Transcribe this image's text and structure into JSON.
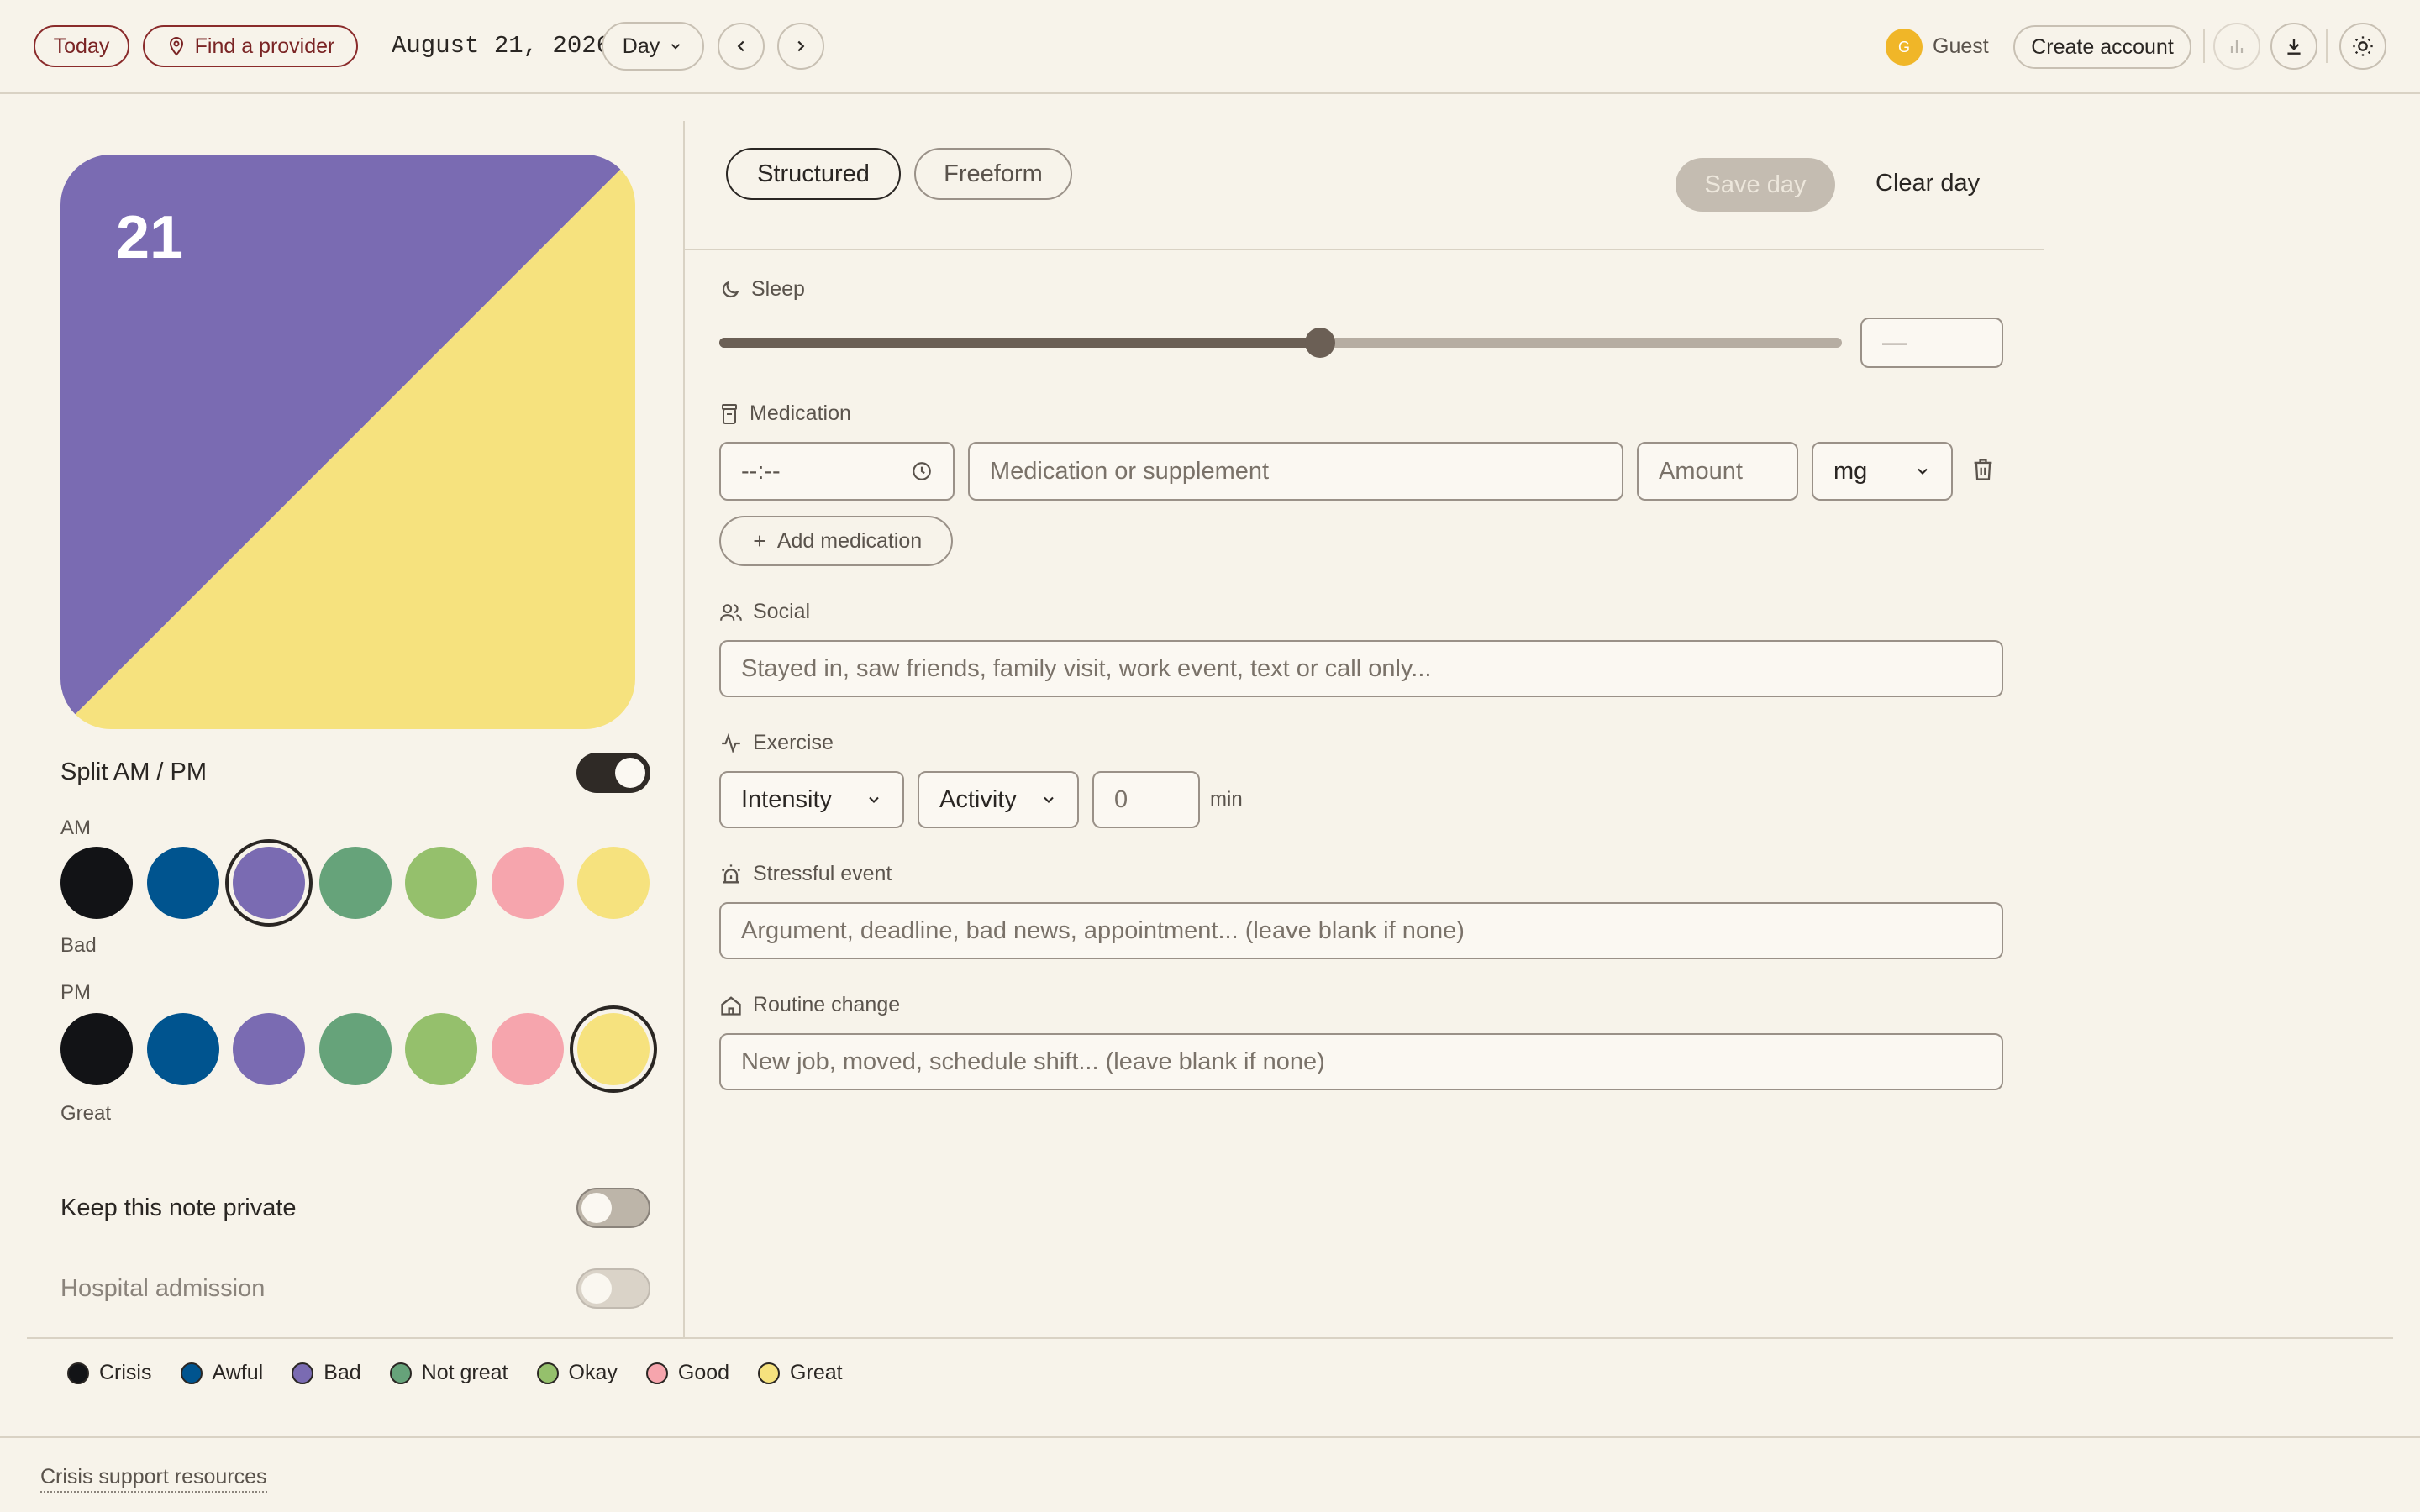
{
  "header": {
    "today_label": "Today",
    "find_provider_label": "Find a provider",
    "date": "August 21, 2026",
    "view_select": "Day",
    "user_initial": "G",
    "user_name": "Guest",
    "create_account_label": "Create account"
  },
  "day_card": {
    "day_number": "21",
    "am_color": "#7a6bb2",
    "pm_color": "#f6e27e"
  },
  "left_panel": {
    "split_label": "Split AM / PM",
    "split_on": true,
    "am_label": "AM",
    "am_mood": "Bad",
    "pm_label": "PM",
    "pm_mood": "Great",
    "private_label": "Keep this note private",
    "hospital_label": "Hospital admission"
  },
  "palette": [
    {
      "name": "Crisis",
      "color": "#121316"
    },
    {
      "name": "Awful",
      "color": "#00548f"
    },
    {
      "name": "Bad",
      "color": "#7a6bb2"
    },
    {
      "name": "Not great",
      "color": "#66a37a"
    },
    {
      "name": "Okay",
      "color": "#95c06c"
    },
    {
      "name": "Good",
      "color": "#f6a5ad"
    },
    {
      "name": "Great",
      "color": "#f6e27e"
    }
  ],
  "tabs": {
    "structured": "Structured",
    "freeform": "Freeform",
    "save_label": "Save day",
    "clear_label": "Clear day"
  },
  "sleep": {
    "label": "Sleep",
    "value_display": "—",
    "slider_fraction": 0.535
  },
  "medication": {
    "label": "Medication",
    "time_value": "--:--",
    "name_placeholder": "Medication or supplement",
    "amount_placeholder": "Amount",
    "unit": "mg",
    "add_label": "Add medication"
  },
  "social": {
    "label": "Social",
    "placeholder": "Stayed in, saw friends, family visit, work event, text or call only..."
  },
  "exercise": {
    "label": "Exercise",
    "intensity": "Intensity",
    "activity": "Activity",
    "minutes": "0",
    "unit": "min"
  },
  "stress": {
    "label": "Stressful event",
    "placeholder": "Argument, deadline, bad news, appointment... (leave blank if none)"
  },
  "routine": {
    "label": "Routine change",
    "placeholder": "New job, moved, schedule shift... (leave blank if none)"
  },
  "legend": [
    "Crisis",
    "Awful",
    "Bad",
    "Not great",
    "Okay",
    "Good",
    "Great"
  ],
  "footer": {
    "crisis_link": "Crisis support resources"
  }
}
